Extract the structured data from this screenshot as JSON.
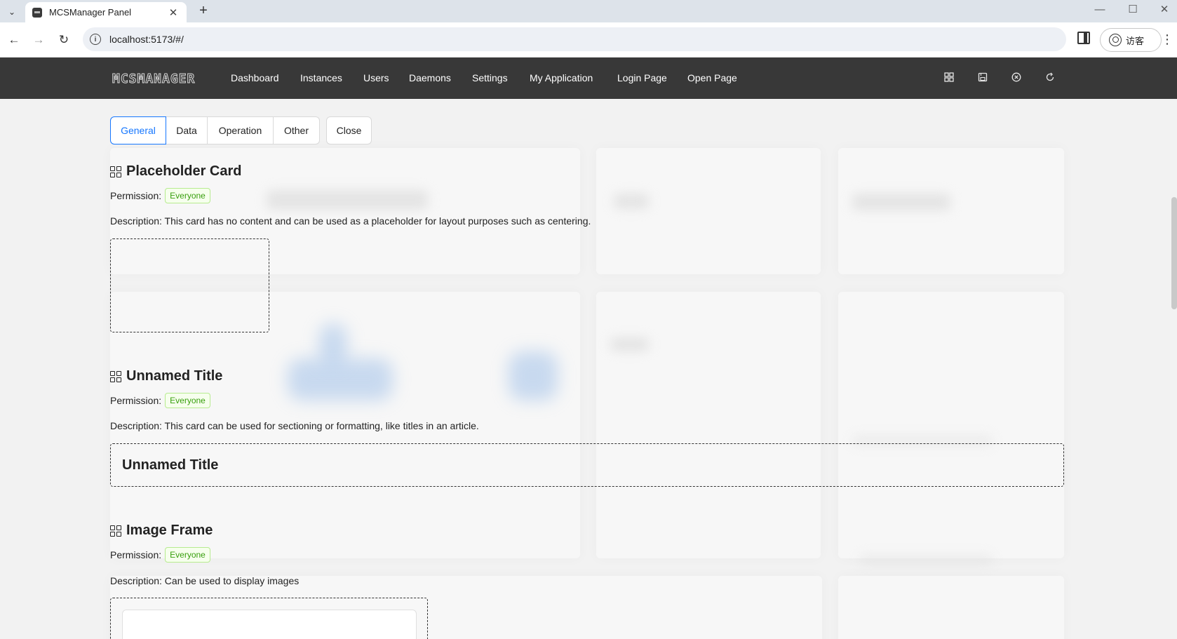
{
  "browser": {
    "tab_title": "MCSManager Panel",
    "url": "localhost:5173/#/",
    "profile_label": "访客"
  },
  "header": {
    "logo": "MCSMANAGER",
    "nav": [
      "Dashboard",
      "Instances",
      "Users",
      "Daemons",
      "Settings",
      "My Application",
      "Login Page",
      "Open Page"
    ],
    "icons": [
      "layout-grid-icon",
      "save-icon",
      "close-circle-icon",
      "reload-icon"
    ]
  },
  "tabs": {
    "general": "General",
    "data": "Data",
    "operation": "Operation",
    "other": "Other",
    "close": "Close"
  },
  "sections": [
    {
      "title": "Placeholder Card",
      "permission_label": "Permission:",
      "permission": "Everyone",
      "description": "Description: This card has no content and can be used as a placeholder for layout purposes such as centering."
    },
    {
      "title": "Unnamed Title",
      "permission_label": "Permission:",
      "permission": "Everyone",
      "description": "Description: This card can be used for sectioning or formatting, like titles in an article.",
      "preview_text": "Unnamed Title"
    },
    {
      "title": "Image Frame",
      "permission_label": "Permission:",
      "permission": "Everyone",
      "description": "Description: Can be used to display images"
    }
  ],
  "colors": {
    "header_bg": "#383838",
    "accent": "#1677ff",
    "badge_text": "#389e0d",
    "badge_bg": "#f6ffed",
    "badge_border": "#b7eb8f"
  }
}
